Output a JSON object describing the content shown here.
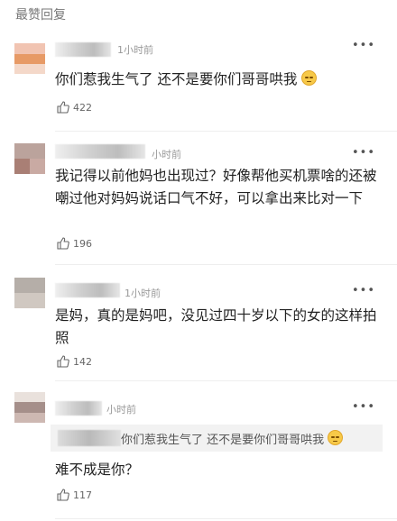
{
  "section": {
    "title": "最赞回复"
  },
  "comments": [
    {
      "time": "1小时前",
      "text": "你们惹我生气了 还不是要你们哥哥哄我",
      "likes": "422"
    },
    {
      "time": "小时前",
      "text": "我记得以前他妈也出现过？好像帮他买机票啥的还被嘲过他对妈妈说话口气不好，可以拿出来比对一下",
      "likes": "196"
    },
    {
      "time": "1小时前",
      "text": "是妈，真的是妈吧，没见过四十岁以下的女的这样拍照",
      "likes": "142"
    },
    {
      "time": "小时前",
      "quote": "你们惹我生气了 还不是要你们哥哥哄我",
      "text": "难不成是你？",
      "likes": "117"
    }
  ],
  "icons": {
    "more": "more-dots-icon",
    "like": "thumbs-up-icon",
    "emoji": "pensive-face-emoji"
  },
  "colors": {
    "text": "#222222",
    "meta": "#999999",
    "quote_bg": "#f2f2f2"
  }
}
